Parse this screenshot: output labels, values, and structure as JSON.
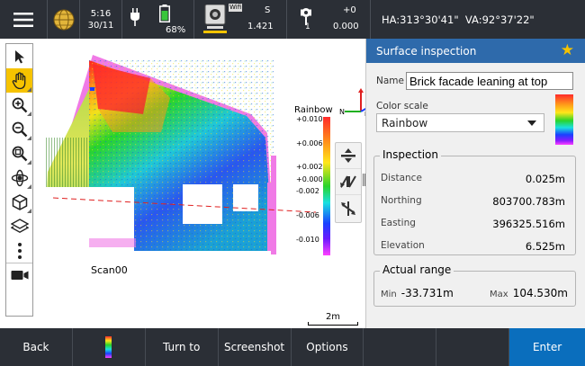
{
  "statusbar": {
    "time": "5:16",
    "date": "30/11",
    "battery_percent": "68%",
    "instrument_mode": "S",
    "instrument_value": "1.421",
    "wifi_label": "Wifi",
    "target_offset": "+0",
    "target_height": "0.000",
    "target_id": "1",
    "angles": "HA:313°30'41\"  VA:92°37'22\""
  },
  "left_tools": [
    "select-arrow-icon",
    "pan-hand-icon",
    "zoom-in-icon",
    "zoom-out-icon",
    "zoom-extents-icon",
    "orbit-icon",
    "cube-view-icon",
    "layers-icon",
    "more-options-icon",
    "video-icon"
  ],
  "view": {
    "scan_label": "Scan00",
    "axis_labels": {
      "n": "N",
      "e": "E"
    },
    "legend": {
      "title": "Rainbow",
      "ticks": [
        "+0.010",
        "+0.006",
        "+0.002",
        "+0.000",
        "-0.002",
        "-0.006",
        "-0.010"
      ]
    },
    "scale_label": "2m"
  },
  "panel": {
    "title": "Surface inspection",
    "name_label": "Name",
    "name_value": "Brick facade leaning at top",
    "color_scale_label": "Color scale",
    "color_scale_value": "Rainbow",
    "inspection": {
      "title": "Inspection",
      "rows": [
        {
          "label": "Distance",
          "value": "0.025m"
        },
        {
          "label": "Northing",
          "value": "803700.783m"
        },
        {
          "label": "Easting",
          "value": "396325.516m"
        },
        {
          "label": "Elevation",
          "value": "6.525m"
        }
      ]
    },
    "range": {
      "title": "Actual range",
      "min_label": "Min",
      "min_value": "-33.731m",
      "max_label": "Max",
      "max_value": "104.530m"
    }
  },
  "bottombar": {
    "back": "Back",
    "turn_to": "Turn to",
    "screenshot": "Screenshot",
    "options": "Options",
    "enter": "Enter"
  },
  "colors": {
    "bar_dark": "#2b2f36",
    "panel_header": "#2e6aab",
    "enter_button": "#0a6ebd",
    "active_tool": "#f6c300",
    "facade_pink": "#f07ae6"
  }
}
